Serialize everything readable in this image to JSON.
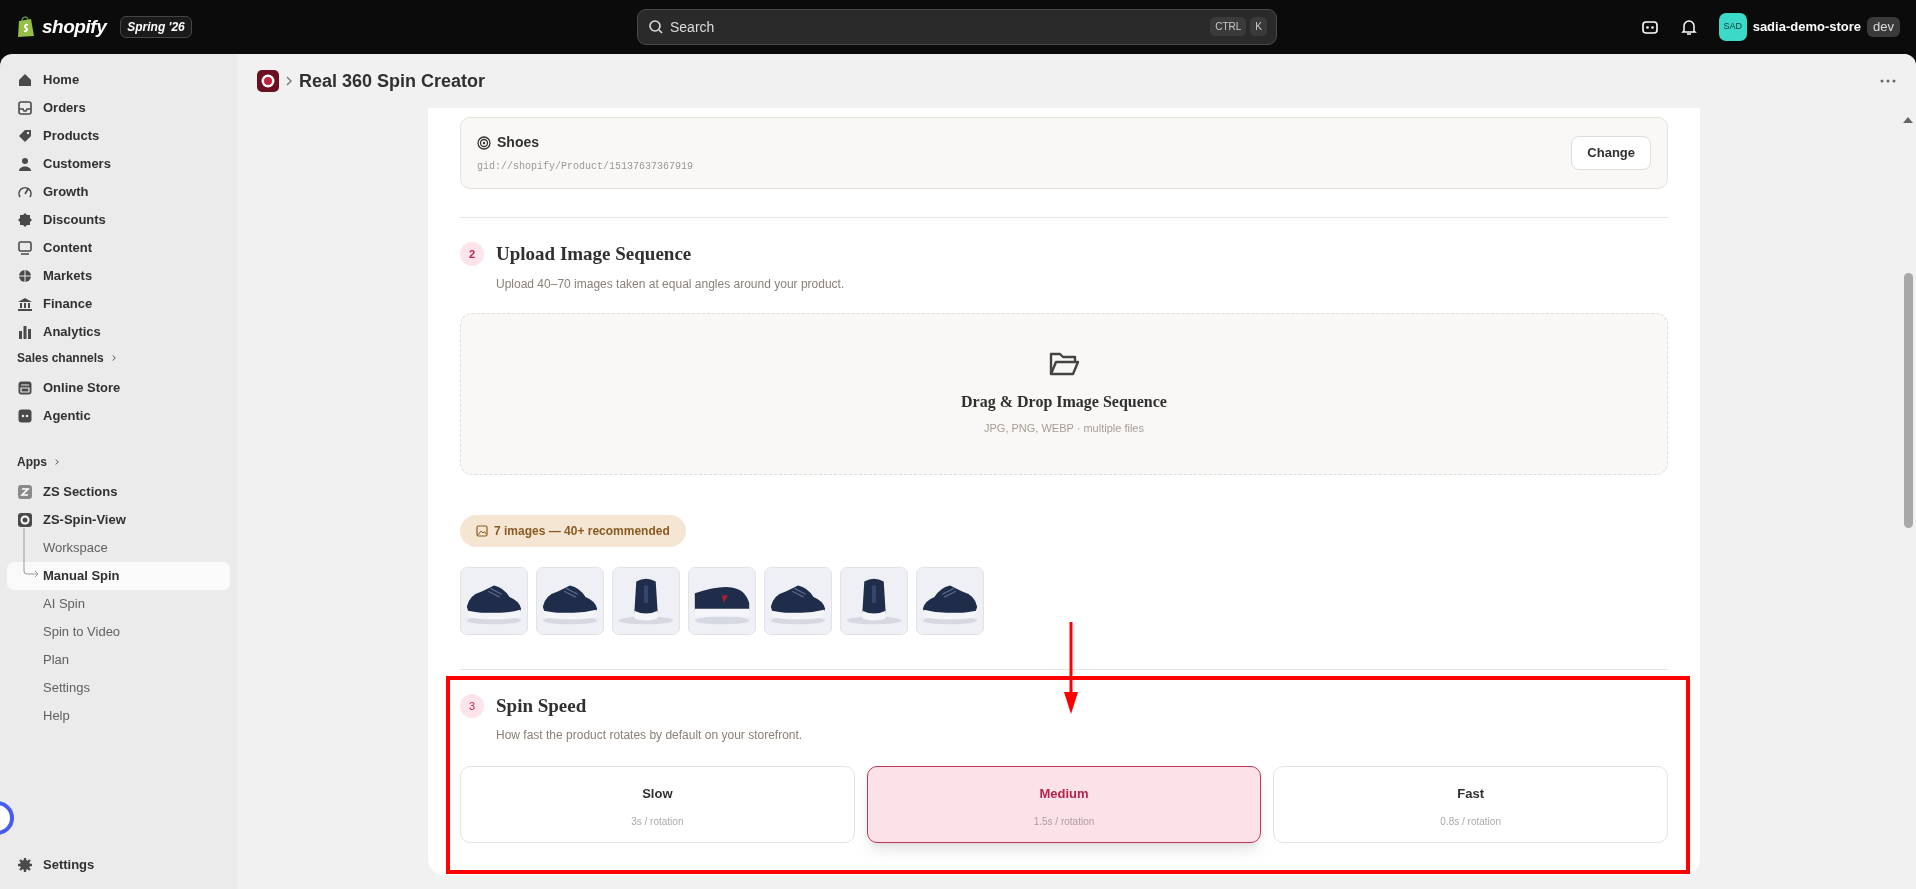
{
  "topbar": {
    "logo": "shopify",
    "edition": "Spring '26",
    "search": {
      "placeholder": "Search",
      "shortcut": [
        "CTRL",
        "K"
      ]
    },
    "store": {
      "avatar": "SAD",
      "name": "sadia-demo-store",
      "badge": "dev"
    }
  },
  "sidebar": {
    "main": [
      {
        "label": "Home"
      },
      {
        "label": "Orders"
      },
      {
        "label": "Products"
      },
      {
        "label": "Customers"
      },
      {
        "label": "Growth"
      },
      {
        "label": "Discounts"
      },
      {
        "label": "Content"
      },
      {
        "label": "Markets"
      },
      {
        "label": "Finance"
      },
      {
        "label": "Analytics"
      }
    ],
    "sales_channels": {
      "label": "Sales channels",
      "items": [
        {
          "label": "Online Store"
        },
        {
          "label": "Agentic"
        }
      ]
    },
    "apps": {
      "label": "Apps",
      "items": [
        {
          "label": "ZS Sections"
        },
        {
          "label": "ZS-Spin-View",
          "children": [
            {
              "label": "Workspace",
              "selected": false
            },
            {
              "label": "Manual Spin",
              "selected": true
            },
            {
              "label": "AI Spin",
              "selected": false
            },
            {
              "label": "Spin to Video",
              "selected": false
            },
            {
              "label": "Plan",
              "selected": false
            },
            {
              "label": "Settings",
              "selected": false
            },
            {
              "label": "Help",
              "selected": false
            }
          ]
        }
      ]
    },
    "footer": {
      "label": "Settings"
    }
  },
  "page": {
    "title": "Real 360 Spin Creator"
  },
  "product": {
    "name": "Shoes",
    "id": "gid://shopify/Product/15137637367919",
    "button": "Change"
  },
  "upload": {
    "number": "2",
    "title": "Upload Image Sequence",
    "subtitle": "Upload 40–70 images taken at equal angles around your product.",
    "dropzone": {
      "title": "Drag & Drop Image Sequence",
      "hint": "JPG, PNG, WEBP · multiple files"
    },
    "badge": "7 images — 40+ recommended"
  },
  "speed": {
    "number": "3",
    "title": "Spin Speed",
    "subtitle": "How fast the product rotates by default on your storefront.",
    "options": [
      {
        "label": "Slow",
        "detail": "3s / rotation",
        "selected": false
      },
      {
        "label": "Medium",
        "detail": "1.5s / rotation",
        "selected": true
      },
      {
        "label": "Fast",
        "detail": "0.8s / rotation",
        "selected": false
      }
    ]
  },
  "annotation": {
    "kind": "highlight-box",
    "arrow": true
  }
}
